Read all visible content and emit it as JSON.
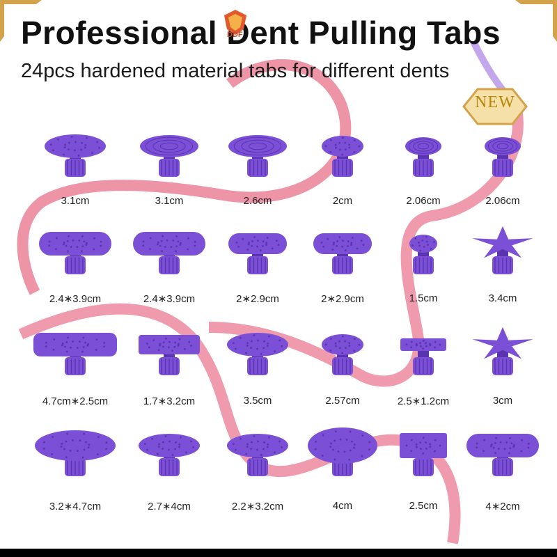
{
  "header": {
    "title": "Professional Dent Pulling Tabs",
    "subtitle": "24pcs hardened material tabs for different dents",
    "logo_text": "DDF",
    "badge": "NEW"
  },
  "colors": {
    "tab_purple": "#7b4fd6",
    "tab_purple_dark": "#5a33b0",
    "ribbon_pink": "#e8708a",
    "gold": "#d4a24a"
  },
  "tabs": [
    {
      "label": "3.1cm",
      "shape": "oval-dotted"
    },
    {
      "label": "3.1cm",
      "shape": "round-ring"
    },
    {
      "label": "2.6cm",
      "shape": "round-ring"
    },
    {
      "label": "2cm",
      "shape": "round-dotted-small"
    },
    {
      "label": "2.06cm",
      "shape": "round-ring-small"
    },
    {
      "label": "2.06cm",
      "shape": "round-ring-small"
    },
    {
      "label": "2.4∗3.9cm",
      "shape": "oblong-dotted"
    },
    {
      "label": "2.4∗3.9cm",
      "shape": "oblong-dotted"
    },
    {
      "label": "2∗2.9cm",
      "shape": "oblong-dotted-small"
    },
    {
      "label": "2∗2.9cm",
      "shape": "oblong-dotted-small"
    },
    {
      "label": "1.5cm",
      "shape": "round-dotted-tiny"
    },
    {
      "label": "3.4cm",
      "shape": "star"
    },
    {
      "label": "4.7cm∗2.5cm",
      "shape": "long-dotted"
    },
    {
      "label": "1.7∗3.2cm",
      "shape": "rect-dotted"
    },
    {
      "label": "3.5cm",
      "shape": "oval-dotted"
    },
    {
      "label": "2.57cm",
      "shape": "round-dotted-small"
    },
    {
      "label": "2.5∗1.2cm",
      "shape": "rect-dotted-small"
    },
    {
      "label": "3cm",
      "shape": "star"
    },
    {
      "label": "3.2∗4.7cm",
      "shape": "oval-large"
    },
    {
      "label": "2.7∗4cm",
      "shape": "oval-dotted"
    },
    {
      "label": "2.2∗3.2cm",
      "shape": "oval-dotted"
    },
    {
      "label": "4cm",
      "shape": "round-large"
    },
    {
      "label": "2.5cm",
      "shape": "square"
    },
    {
      "label": "4∗2cm",
      "shape": "oblong-dotted"
    }
  ]
}
